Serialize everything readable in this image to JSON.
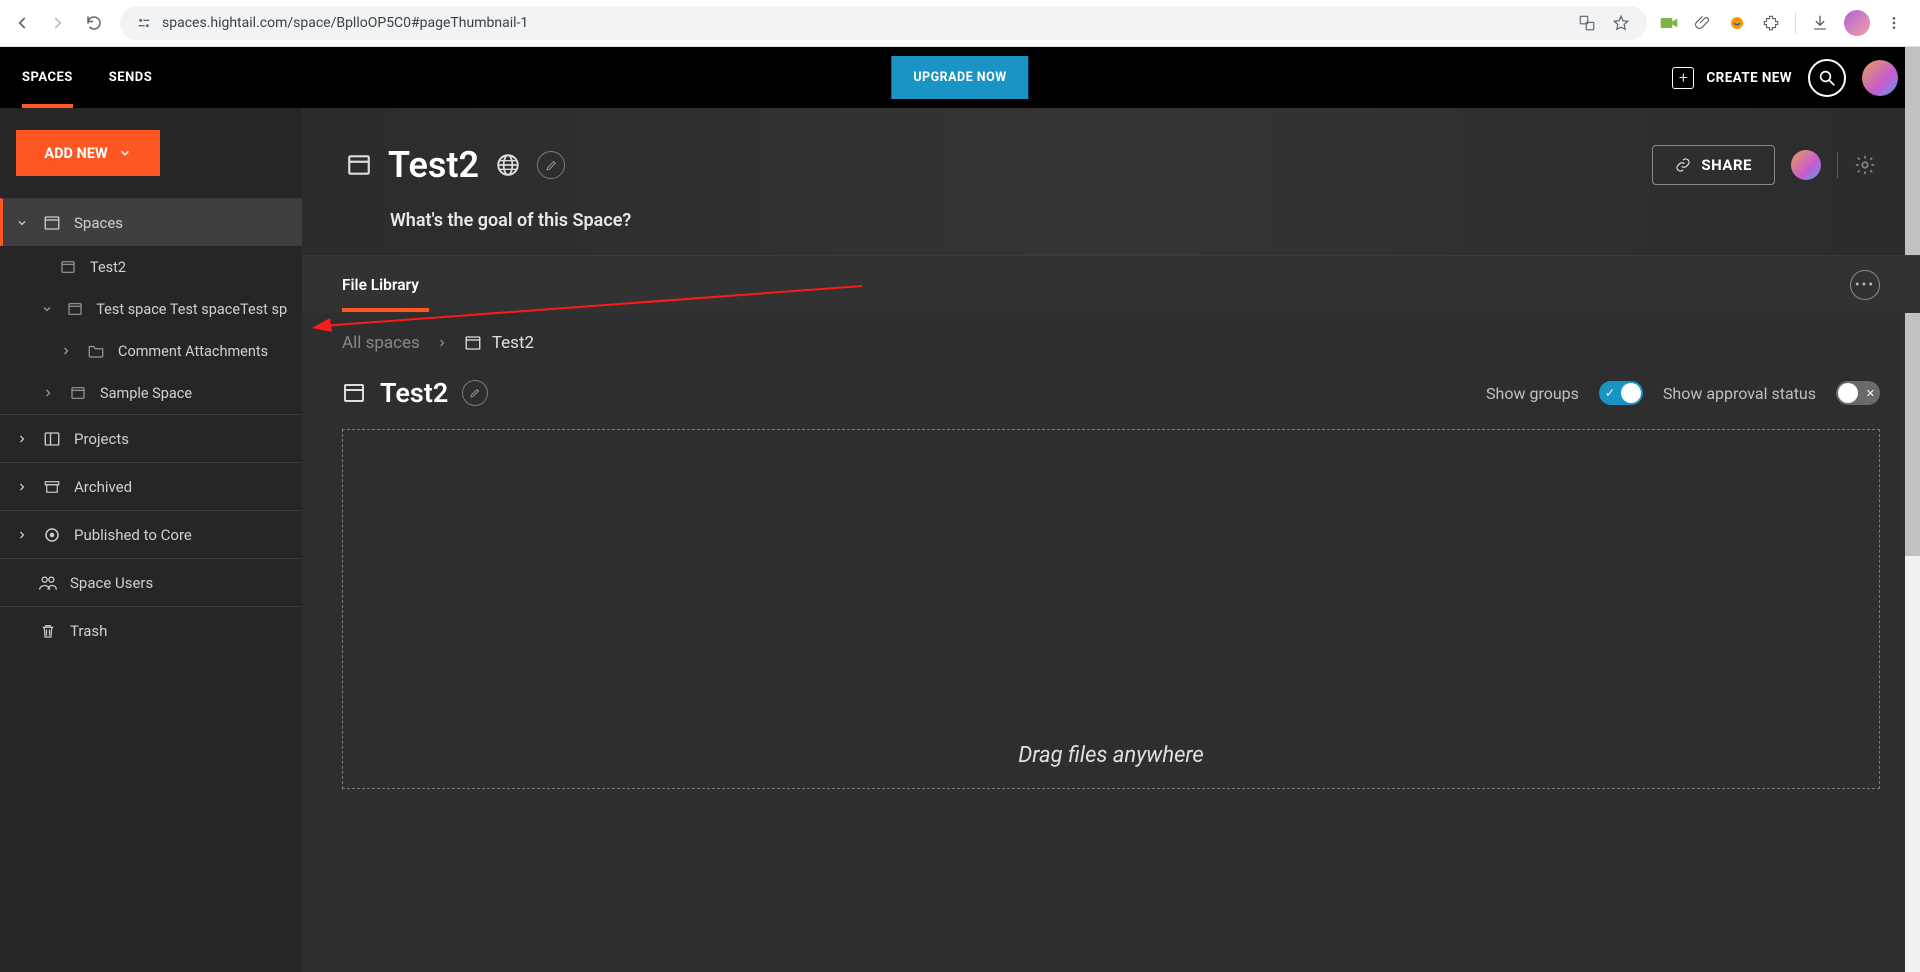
{
  "browser": {
    "url": "spaces.hightail.com/space/BplloOP5C0#pageThumbnail-1"
  },
  "app_header": {
    "tabs": [
      "SPACES",
      "SENDS"
    ],
    "upgrade": "UPGRADE NOW",
    "create": "CREATE NEW"
  },
  "sidebar": {
    "add_new": "ADD NEW",
    "spaces_label": "Spaces",
    "items": {
      "test2": "Test2",
      "long_space": "Test space Test spaceTest space",
      "comment_attach": "Comment Attachments",
      "sample": "Sample Space"
    },
    "projects": "Projects",
    "archived": "Archived",
    "published": "Published to Core",
    "space_users": "Space Users",
    "trash": "Trash"
  },
  "content": {
    "title": "Test2",
    "goal": "What's the goal of this Space?",
    "share": "SHARE",
    "file_library": "File Library",
    "breadcrumb_root": "All spaces",
    "breadcrumb_current": "Test2",
    "section_title": "Test2",
    "show_groups": "Show groups",
    "show_approval": "Show approval status",
    "dropzone": "Drag files anywhere"
  }
}
